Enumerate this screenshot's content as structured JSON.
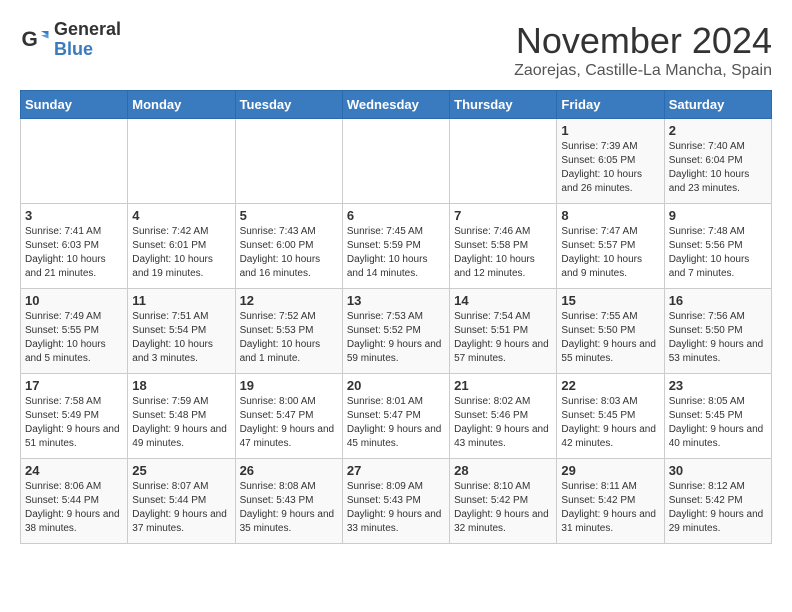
{
  "logo": {
    "general": "General",
    "blue": "Blue"
  },
  "title": {
    "month": "November 2024",
    "location": "Zaorejas, Castille-La Mancha, Spain"
  },
  "days_of_week": [
    "Sunday",
    "Monday",
    "Tuesday",
    "Wednesday",
    "Thursday",
    "Friday",
    "Saturday"
  ],
  "weeks": [
    [
      {
        "day": "",
        "info": ""
      },
      {
        "day": "",
        "info": ""
      },
      {
        "day": "",
        "info": ""
      },
      {
        "day": "",
        "info": ""
      },
      {
        "day": "",
        "info": ""
      },
      {
        "day": "1",
        "info": "Sunrise: 7:39 AM\nSunset: 6:05 PM\nDaylight: 10 hours and 26 minutes."
      },
      {
        "day": "2",
        "info": "Sunrise: 7:40 AM\nSunset: 6:04 PM\nDaylight: 10 hours and 23 minutes."
      }
    ],
    [
      {
        "day": "3",
        "info": "Sunrise: 7:41 AM\nSunset: 6:03 PM\nDaylight: 10 hours and 21 minutes."
      },
      {
        "day": "4",
        "info": "Sunrise: 7:42 AM\nSunset: 6:01 PM\nDaylight: 10 hours and 19 minutes."
      },
      {
        "day": "5",
        "info": "Sunrise: 7:43 AM\nSunset: 6:00 PM\nDaylight: 10 hours and 16 minutes."
      },
      {
        "day": "6",
        "info": "Sunrise: 7:45 AM\nSunset: 5:59 PM\nDaylight: 10 hours and 14 minutes."
      },
      {
        "day": "7",
        "info": "Sunrise: 7:46 AM\nSunset: 5:58 PM\nDaylight: 10 hours and 12 minutes."
      },
      {
        "day": "8",
        "info": "Sunrise: 7:47 AM\nSunset: 5:57 PM\nDaylight: 10 hours and 9 minutes."
      },
      {
        "day": "9",
        "info": "Sunrise: 7:48 AM\nSunset: 5:56 PM\nDaylight: 10 hours and 7 minutes."
      }
    ],
    [
      {
        "day": "10",
        "info": "Sunrise: 7:49 AM\nSunset: 5:55 PM\nDaylight: 10 hours and 5 minutes."
      },
      {
        "day": "11",
        "info": "Sunrise: 7:51 AM\nSunset: 5:54 PM\nDaylight: 10 hours and 3 minutes."
      },
      {
        "day": "12",
        "info": "Sunrise: 7:52 AM\nSunset: 5:53 PM\nDaylight: 10 hours and 1 minute."
      },
      {
        "day": "13",
        "info": "Sunrise: 7:53 AM\nSunset: 5:52 PM\nDaylight: 9 hours and 59 minutes."
      },
      {
        "day": "14",
        "info": "Sunrise: 7:54 AM\nSunset: 5:51 PM\nDaylight: 9 hours and 57 minutes."
      },
      {
        "day": "15",
        "info": "Sunrise: 7:55 AM\nSunset: 5:50 PM\nDaylight: 9 hours and 55 minutes."
      },
      {
        "day": "16",
        "info": "Sunrise: 7:56 AM\nSunset: 5:50 PM\nDaylight: 9 hours and 53 minutes."
      }
    ],
    [
      {
        "day": "17",
        "info": "Sunrise: 7:58 AM\nSunset: 5:49 PM\nDaylight: 9 hours and 51 minutes."
      },
      {
        "day": "18",
        "info": "Sunrise: 7:59 AM\nSunset: 5:48 PM\nDaylight: 9 hours and 49 minutes."
      },
      {
        "day": "19",
        "info": "Sunrise: 8:00 AM\nSunset: 5:47 PM\nDaylight: 9 hours and 47 minutes."
      },
      {
        "day": "20",
        "info": "Sunrise: 8:01 AM\nSunset: 5:47 PM\nDaylight: 9 hours and 45 minutes."
      },
      {
        "day": "21",
        "info": "Sunrise: 8:02 AM\nSunset: 5:46 PM\nDaylight: 9 hours and 43 minutes."
      },
      {
        "day": "22",
        "info": "Sunrise: 8:03 AM\nSunset: 5:45 PM\nDaylight: 9 hours and 42 minutes."
      },
      {
        "day": "23",
        "info": "Sunrise: 8:05 AM\nSunset: 5:45 PM\nDaylight: 9 hours and 40 minutes."
      }
    ],
    [
      {
        "day": "24",
        "info": "Sunrise: 8:06 AM\nSunset: 5:44 PM\nDaylight: 9 hours and 38 minutes."
      },
      {
        "day": "25",
        "info": "Sunrise: 8:07 AM\nSunset: 5:44 PM\nDaylight: 9 hours and 37 minutes."
      },
      {
        "day": "26",
        "info": "Sunrise: 8:08 AM\nSunset: 5:43 PM\nDaylight: 9 hours and 35 minutes."
      },
      {
        "day": "27",
        "info": "Sunrise: 8:09 AM\nSunset: 5:43 PM\nDaylight: 9 hours and 33 minutes."
      },
      {
        "day": "28",
        "info": "Sunrise: 8:10 AM\nSunset: 5:42 PM\nDaylight: 9 hours and 32 minutes."
      },
      {
        "day": "29",
        "info": "Sunrise: 8:11 AM\nSunset: 5:42 PM\nDaylight: 9 hours and 31 minutes."
      },
      {
        "day": "30",
        "info": "Sunrise: 8:12 AM\nSunset: 5:42 PM\nDaylight: 9 hours and 29 minutes."
      }
    ]
  ]
}
